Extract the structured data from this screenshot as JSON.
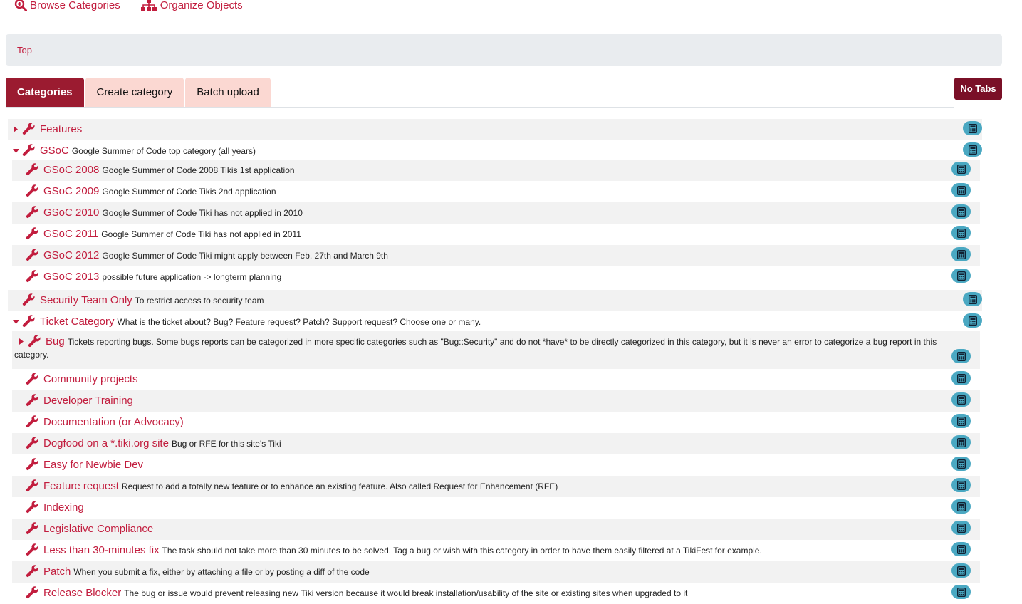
{
  "top_links": [
    {
      "label": "Browse Categories",
      "icon": "search-plus-icon"
    },
    {
      "label": "Organize Objects",
      "icon": "sitemap-icon"
    }
  ],
  "breadcrumb": {
    "top": "Top"
  },
  "tabs": [
    {
      "label": "Categories",
      "active": true
    },
    {
      "label": "Create category",
      "active": false
    },
    {
      "label": "Batch upload",
      "active": false
    }
  ],
  "no_tabs_label": "No Tabs",
  "colors": {
    "accent": "#c21d3e",
    "active_tab": "#9b1b30",
    "inactive_tab": "#fbd8d2",
    "badge": "#4aa8c2"
  },
  "categories": [
    {
      "name": "Features",
      "description": "",
      "caret": "right"
    },
    {
      "name": "GSoC",
      "description": "Google Summer of Code top category (all years)",
      "caret": "down"
    },
    {
      "name": "GSoC 2008",
      "description": "Google Summer of Code 2008 Tikis 1st application"
    },
    {
      "name": "GSoC 2009",
      "description": "Google Summer of Code Tikis 2nd application"
    },
    {
      "name": "GSoC 2010",
      "description": "Google Summer of Code Tiki has not applied in 2010"
    },
    {
      "name": "GSoC 2011",
      "description": "Google Summer of Code Tiki has not applied in 2011"
    },
    {
      "name": "GSoC 2012",
      "description": "Google Summer of Code Tiki might apply between Feb. 27th and March 9th"
    },
    {
      "name": "GSoC 2013",
      "description": "possible future application -> longterm planning"
    },
    {
      "name": "Security Team Only",
      "description": "To restrict access to security team"
    },
    {
      "name": "Ticket Category",
      "description": "What is the ticket about? Bug? Feature request? Patch? Support request? Choose one or many.",
      "caret": "down"
    },
    {
      "name": "Bug",
      "description": "Tickets reporting bugs. Some bugs reports can be categorized in more specific categories such as \"Bug::Security\" and do not *have* to be directly categorized in this category, but it is never an error to categorize a bug report in this",
      "description_wrap": "category.",
      "caret": "right"
    },
    {
      "name": "Community projects",
      "description": ""
    },
    {
      "name": "Developer Training",
      "description": ""
    },
    {
      "name": "Documentation (or Advocacy)",
      "description": ""
    },
    {
      "name": "Dogfood on a *.tiki.org site",
      "description": "Bug or RFE for this site's Tiki"
    },
    {
      "name": "Easy for Newbie Dev",
      "description": ""
    },
    {
      "name": "Feature request",
      "description": "Request to add a totally new feature or to enhance an existing feature. Also called Request for Enhancement (RFE)"
    },
    {
      "name": "Indexing",
      "description": ""
    },
    {
      "name": "Legislative Compliance",
      "description": ""
    },
    {
      "name": "Less than 30-minutes fix",
      "description": "The task should not take more than 30 minutes to be solved. Tag a bug or wish with this category in order to have them easily filtered at a TikiFest for example."
    },
    {
      "name": "Patch",
      "description": "When you submit a fix, either by attaching a file or by posting a diff of the code"
    },
    {
      "name": "Release Blocker",
      "description": "The bug or issue would prevent releasing new Tiki version because it would break installation/usability of the site or existing sites when upgraded to it"
    }
  ]
}
